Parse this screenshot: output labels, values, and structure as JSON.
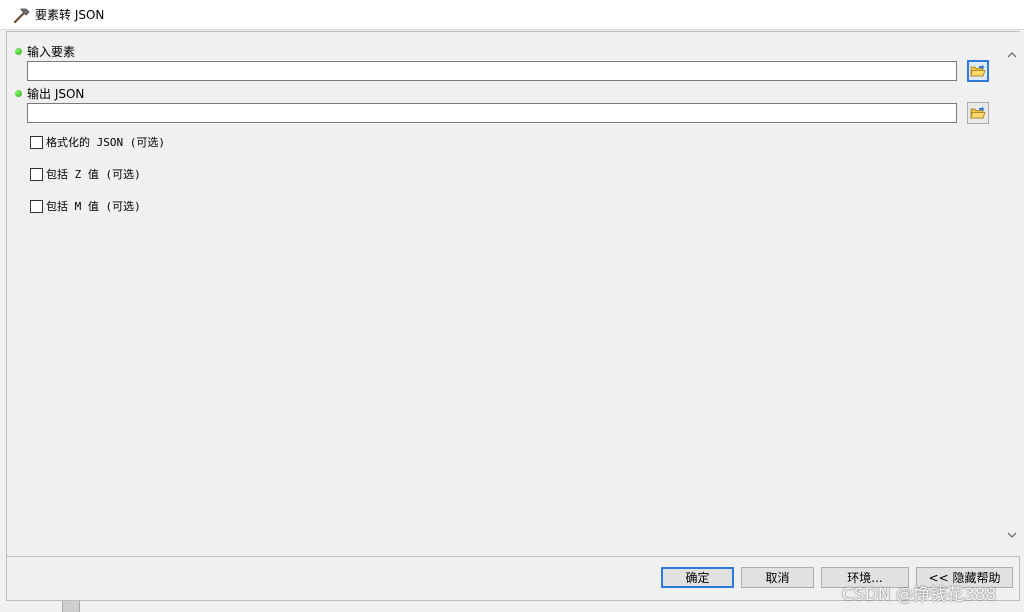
{
  "window": {
    "title": "要素转 JSON",
    "title_icon": "hammer-icon"
  },
  "params": {
    "input_features": {
      "label": "输入要素",
      "value": "",
      "required": true
    },
    "output_json": {
      "label": "输出 JSON",
      "value": "",
      "required": true
    }
  },
  "options": [
    {
      "label": "格式化的 JSON (可选)",
      "checked": false
    },
    {
      "label": "包括 Z 值 (可选)",
      "checked": false
    },
    {
      "label": "包括 M 值 (可选)",
      "checked": false
    }
  ],
  "buttons": {
    "ok": "确定",
    "cancel": "取消",
    "environments": "环境...",
    "hide_help": "<< 隐藏帮助"
  },
  "watermark": "CSDN @挣钱花388",
  "colors": {
    "required_dot": "#1fae14",
    "focus_border": "#2f7ad8"
  }
}
